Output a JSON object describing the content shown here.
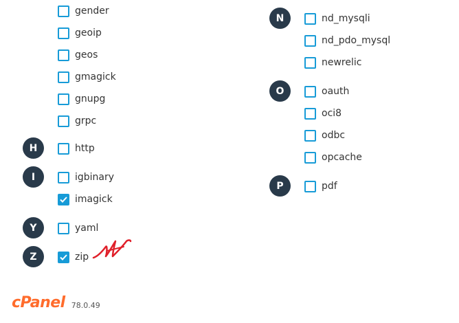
{
  "left_column": {
    "g_items": [
      {
        "label": "gender",
        "checked": false
      },
      {
        "label": "geoip",
        "checked": false
      },
      {
        "label": "geos",
        "checked": false
      },
      {
        "label": "gmagick",
        "checked": false
      },
      {
        "label": "gnupg",
        "checked": false
      },
      {
        "label": "grpc",
        "checked": false
      }
    ],
    "groups": [
      {
        "letter": "H",
        "items": [
          {
            "label": "http",
            "checked": false
          }
        ]
      },
      {
        "letter": "I",
        "items": [
          {
            "label": "igbinary",
            "checked": false
          },
          {
            "label": "imagick",
            "checked": true
          }
        ]
      },
      {
        "letter": "Y",
        "items": [
          {
            "label": "yaml",
            "checked": false
          }
        ]
      },
      {
        "letter": "Z",
        "items": [
          {
            "label": "zip",
            "checked": true
          }
        ]
      }
    ]
  },
  "right_column": {
    "groups": [
      {
        "letter": "N",
        "items": [
          {
            "label": "nd_mysqli",
            "checked": false
          },
          {
            "label": "nd_pdo_mysql",
            "checked": false
          },
          {
            "label": "newrelic",
            "checked": false
          }
        ]
      },
      {
        "letter": "O",
        "items": [
          {
            "label": "oauth",
            "checked": false
          },
          {
            "label": "oci8",
            "checked": false
          },
          {
            "label": "odbc",
            "checked": false
          },
          {
            "label": "opcache",
            "checked": false
          }
        ]
      },
      {
        "letter": "P",
        "items": [
          {
            "label": "pdf",
            "checked": false
          }
        ]
      }
    ]
  },
  "footer": {
    "logo": "cPanel",
    "version": "78.0.49"
  },
  "colors": {
    "letter_badge": "#293a4a",
    "checkbox": "#179bd7",
    "logo": "#ff6c2c",
    "scribble": "#e0202a"
  }
}
